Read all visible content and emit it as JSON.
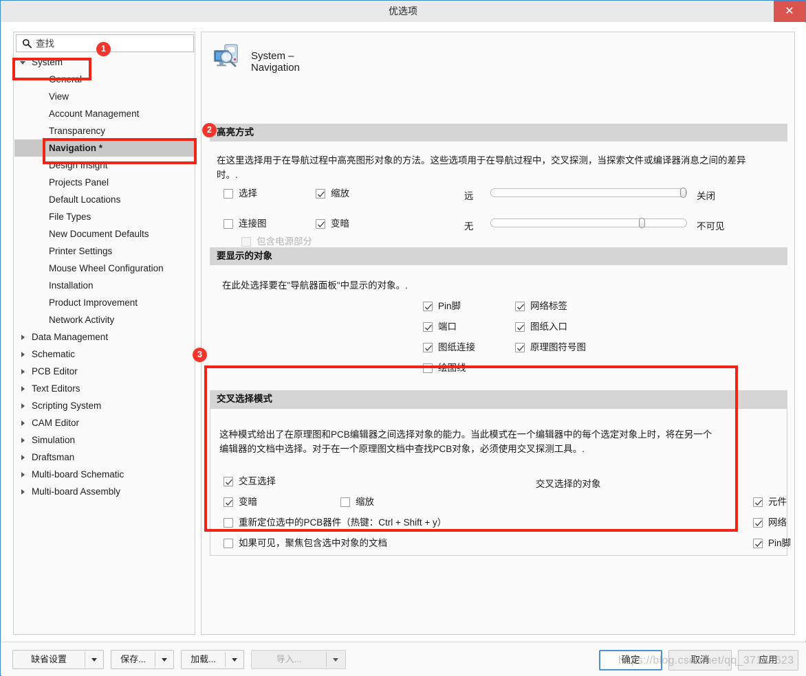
{
  "window": {
    "title": "优选项",
    "close_label": "✕"
  },
  "search": {
    "value": "查找",
    "icon": "search-icon"
  },
  "sidebar": {
    "items": [
      {
        "label": "System",
        "level": 0,
        "expanded": true,
        "selected": false
      },
      {
        "label": "General",
        "level": 1,
        "selected": false
      },
      {
        "label": "View",
        "level": 1,
        "selected": false
      },
      {
        "label": "Account Management",
        "level": 1,
        "selected": false
      },
      {
        "label": "Transparency",
        "level": 1,
        "selected": false
      },
      {
        "label": "Navigation *",
        "level": 1,
        "selected": true
      },
      {
        "label": "Design Insight",
        "level": 1,
        "selected": false
      },
      {
        "label": "Projects Panel",
        "level": 1,
        "selected": false
      },
      {
        "label": "Default Locations",
        "level": 1,
        "selected": false
      },
      {
        "label": "File Types",
        "level": 1,
        "selected": false
      },
      {
        "label": "New Document Defaults",
        "level": 1,
        "selected": false
      },
      {
        "label": "Printer Settings",
        "level": 1,
        "selected": false
      },
      {
        "label": "Mouse Wheel Configuration",
        "level": 1,
        "selected": false
      },
      {
        "label": "Installation",
        "level": 1,
        "selected": false
      },
      {
        "label": "Product Improvement",
        "level": 1,
        "selected": false
      },
      {
        "label": "Network Activity",
        "level": 1,
        "selected": false
      },
      {
        "label": "Data Management",
        "level": 0,
        "expanded": false,
        "selected": false
      },
      {
        "label": "Schematic",
        "level": 0,
        "expanded": false,
        "selected": false
      },
      {
        "label": "PCB Editor",
        "level": 0,
        "expanded": false,
        "selected": false
      },
      {
        "label": "Text Editors",
        "level": 0,
        "expanded": false,
        "selected": false
      },
      {
        "label": "Scripting System",
        "level": 0,
        "expanded": false,
        "selected": false
      },
      {
        "label": "CAM Editor",
        "level": 0,
        "expanded": false,
        "selected": false
      },
      {
        "label": "Simulation",
        "level": 0,
        "expanded": false,
        "selected": false
      },
      {
        "label": "Draftsman",
        "level": 0,
        "expanded": false,
        "selected": false
      },
      {
        "label": "Multi-board Schematic",
        "level": 0,
        "expanded": false,
        "selected": false
      },
      {
        "label": "Multi-board Assembly",
        "level": 0,
        "expanded": false,
        "selected": false
      }
    ]
  },
  "page": {
    "title": "System – Navigation",
    "icon": "monitor-magnifier-icon"
  },
  "highlight_section": {
    "header": "高亮方式",
    "description_line1": "在这里选择用于在导航过程中高亮图形对象的方法。这些选项用于在导航过程中，交叉探测，当探索文件或编译器消息之间的差异",
    "description_line2": "时。.",
    "checkboxes": {
      "select": {
        "label": "选择",
        "checked": false
      },
      "zoom": {
        "label": "缩放",
        "checked": true
      },
      "connective_graph": {
        "label": "连接图",
        "checked": false
      },
      "dim": {
        "label": "变暗",
        "checked": true
      },
      "include_power": {
        "label": "包含电源部分",
        "checked": false,
        "disabled": true
      }
    },
    "slider_zoom": {
      "left_label": "远",
      "right_label": "关闭",
      "value": 100
    },
    "slider_dim": {
      "left_label": "无",
      "right_label": "不可见",
      "value": 78
    }
  },
  "objects_section": {
    "header": "要显示的对象",
    "description": "在此处选择要在\"导航器面板\"中显示的对象。.",
    "items_col1": [
      {
        "label": "Pin脚",
        "checked": true
      },
      {
        "label": "端口",
        "checked": true
      },
      {
        "label": "图纸连接",
        "checked": true
      },
      {
        "label": "绘图线",
        "checked": false
      }
    ],
    "items_col2": [
      {
        "label": "网络标签",
        "checked": true
      },
      {
        "label": "图纸入口",
        "checked": true
      },
      {
        "label": "原理图符号图",
        "checked": true
      }
    ]
  },
  "cross_select_section": {
    "header": "交叉选择模式",
    "description_line1": "这种模式给出了在原理图和PCB编辑器之间选择对象的能力。当此模式在一个编辑器中的每个选定对象上时，将在另一个",
    "description_line2": "编辑器的文档中选择。对于在一个原理图文档中查找PCB对象，必须使用交叉探测工具。.",
    "interactive_select": {
      "label": "交互选择",
      "checked": true
    },
    "dim": {
      "label": "变暗",
      "checked": true
    },
    "zoom": {
      "label": "缩放",
      "checked": false
    },
    "reposition": {
      "label": "重新定位选中的PCB器件（热键：Ctrl + Shift + y）",
      "checked": false
    },
    "focus_doc": {
      "label": "如果可见，聚焦包含选中对象的文档",
      "checked": false
    },
    "objects_title": "交叉选择的对象",
    "objects": [
      {
        "label": "元件",
        "checked": true
      },
      {
        "label": "网络",
        "checked": true
      },
      {
        "label": "Pin脚",
        "checked": true
      }
    ]
  },
  "footer": {
    "defaults": "缺省设置",
    "save": "保存...",
    "load": "加载...",
    "import": "导入...",
    "ok": "确定",
    "cancel": "取消",
    "apply": "应用"
  },
  "annotations": {
    "badge1": "1",
    "badge2": "2",
    "badge3": "3"
  },
  "watermark": "https://blog.csdn.net/qq_37142623"
}
